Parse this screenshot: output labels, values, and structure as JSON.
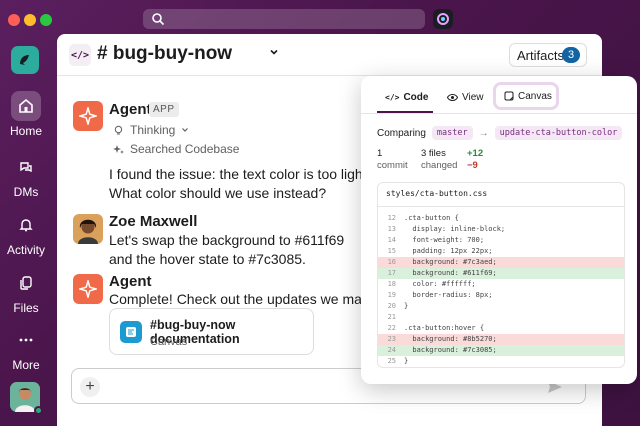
{
  "colors": {
    "brand": "#4a154b",
    "agent_accent": "#f06a4a",
    "link_blue": "#1264a3",
    "added_bg": "#d9f0dc",
    "removed_bg": "#fbdada"
  },
  "titlebar": {
    "search_icon": "search-icon",
    "app_icon": "slack-ai-icon"
  },
  "sidebar": {
    "items": [
      {
        "label": "Home",
        "icon": "home-icon",
        "active": true
      },
      {
        "label": "DMs",
        "icon": "chat-bubbles-icon"
      },
      {
        "label": "Activity",
        "icon": "bell-icon"
      },
      {
        "label": "Files",
        "icon": "files-icon"
      },
      {
        "label": "More",
        "icon": "ellipsis-icon"
      }
    ]
  },
  "channel": {
    "icon_text": "</>",
    "name": "# bug-buy-now",
    "artifacts_label": "Artifacts",
    "artifacts_count": "3"
  },
  "messages": [
    {
      "author": "Agent",
      "badge": "APP",
      "thinking": "Thinking",
      "searched": "Searched Codebase",
      "lines": [
        "I found the issue: the text color is too light.",
        "What color should we use instead?"
      ]
    },
    {
      "author": "Zoe Maxwell",
      "lines": [
        "Let's swap the background to #611f69",
        "and the hover state to #7c3085."
      ]
    },
    {
      "author": "Agent",
      "lines": [
        "Complete! Check out the updates we made:"
      ],
      "card": {
        "title": "#bug-buy-now documentation",
        "subtitle": "Canvas"
      }
    }
  ],
  "composer": {
    "plus": "+"
  },
  "panel": {
    "tabs": [
      {
        "label": "Code",
        "icon_text": "</>"
      },
      {
        "label": "View",
        "icon": "eye-icon"
      },
      {
        "label": "Canvas",
        "icon": "canvas-icon"
      }
    ],
    "comparing_label": "Comparing",
    "base_branch": "master",
    "arrow": "→",
    "head_branch": "update-cta-button-color",
    "commits_value": "1",
    "commits_label": "commit",
    "files_value": "3 files",
    "files_label": "changed",
    "additions": "+12",
    "deletions": "−9",
    "file_name": "styles/cta-button.css",
    "code": [
      {
        "n": "12",
        "t": ".cta-button {",
        "k": ""
      },
      {
        "n": "13",
        "t": "  display: inline-block;",
        "k": ""
      },
      {
        "n": "14",
        "t": "  font-weight: 700;",
        "k": ""
      },
      {
        "n": "15",
        "t": "  padding: 12px 22px;",
        "k": ""
      },
      {
        "n": "16",
        "t": "  background: #7c3aed;",
        "k": "del"
      },
      {
        "n": "17",
        "t": "  background: #611f69;",
        "k": "add"
      },
      {
        "n": "18",
        "t": "  color: #ffffff;",
        "k": ""
      },
      {
        "n": "19",
        "t": "  border-radius: 8px;",
        "k": ""
      },
      {
        "n": "20",
        "t": "}",
        "k": ""
      },
      {
        "n": "21",
        "t": "",
        "k": ""
      },
      {
        "n": "22",
        "t": ".cta-button:hover {",
        "k": ""
      },
      {
        "n": "23",
        "t": "  background: #8b5270;",
        "k": "del"
      },
      {
        "n": "24",
        "t": "  background: #7c3085;",
        "k": "add"
      },
      {
        "n": "25",
        "t": "}",
        "k": ""
      }
    ]
  }
}
